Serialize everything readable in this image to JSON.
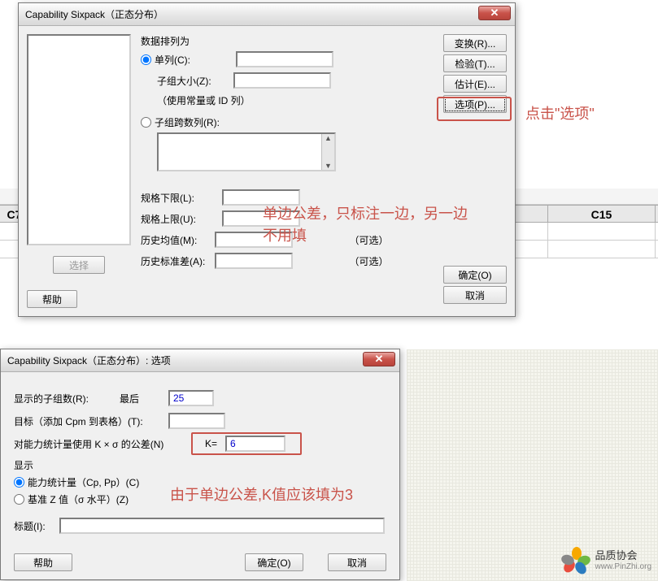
{
  "dialog1": {
    "title": "Capability Sixpack（正态分布）",
    "arrangement_label": "数据排列为",
    "radio_single": "单列(C):",
    "subgroup_size": "子组大小(Z):",
    "subgroup_hint": "（使用常量或 ID 列）",
    "radio_cross": "子组跨数列(R):",
    "lower_spec": "规格下限(L):",
    "upper_spec": "规格上限(U):",
    "hist_mean": "历史均值(M):",
    "hist_sd": "历史标准差(A):",
    "optional": "（可选）",
    "btn_select": "选择",
    "btn_help": "帮助",
    "btn_transform": "变换(R)...",
    "btn_test": "检验(T)...",
    "btn_estimate": "估计(E)...",
    "btn_options": "选项(P)...",
    "btn_ok": "确定(O)",
    "btn_cancel": "取消"
  },
  "annotations": {
    "click_options": "点击\"选项\"",
    "tolerance_note": "单边公差，只标注一边，另一边不用填",
    "k_note": "由于单边公差,K值应该填为3"
  },
  "spreadsheet": {
    "col_left": "C7",
    "col_right": "C15"
  },
  "dialog2": {
    "title": "Capability Sixpack（正态分布）: 选项",
    "show_groups": "显示的子组数(R):",
    "last": "最后",
    "show_groups_val": "25",
    "target": "目标（添加 Cpm 到表格）(T):",
    "k_tolerance": "对能力统计量使用 K × σ 的公差(N)",
    "k_label": "K=",
    "k_value": "6",
    "display": "显示",
    "radio_cap": "能力统计量（Cp, Pp）(C)",
    "radio_z": "基准 Z 值（σ 水平）(Z)",
    "title_label": "标题(I):",
    "btn_help": "帮助",
    "btn_ok": "确定(O)",
    "btn_cancel": "取消"
  },
  "logo": {
    "line1": "品质协会",
    "line2": "www.PinZhi.org"
  }
}
